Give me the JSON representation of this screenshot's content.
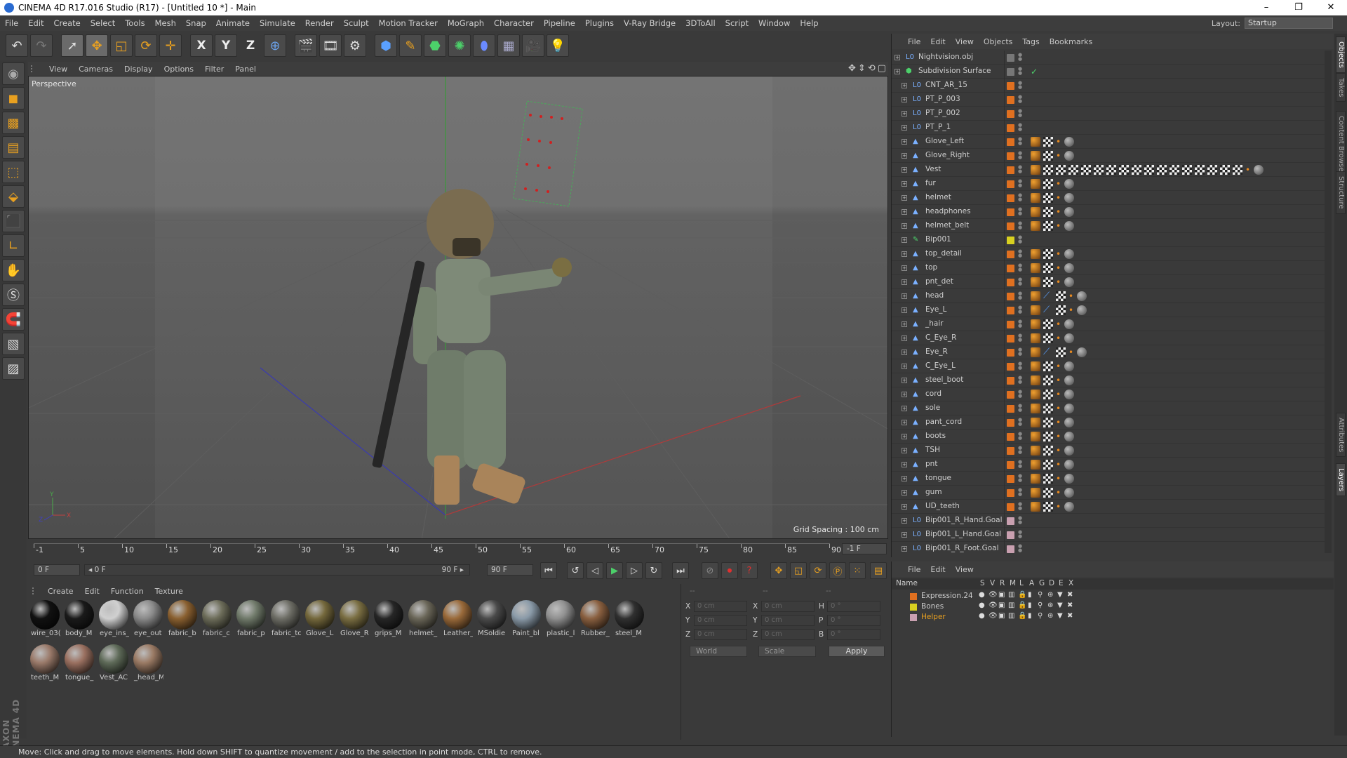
{
  "title": "CINEMA 4D R17.016 Studio (R17) - [Untitled 10 *] - Main",
  "window_controls": [
    "–",
    "❐",
    "✕"
  ],
  "menu": [
    "File",
    "Edit",
    "Create",
    "Select",
    "Tools",
    "Mesh",
    "Snap",
    "Animate",
    "Simulate",
    "Render",
    "Sculpt",
    "Motion Tracker",
    "MoGraph",
    "Character",
    "Pipeline",
    "Plugins",
    "V-Ray Bridge",
    "3DToAll",
    "Script",
    "Window",
    "Help"
  ],
  "layout_label": "Layout:",
  "layout_value": "Startup",
  "axis_buttons": [
    "X",
    "Y",
    "Z"
  ],
  "viewport": {
    "menu": [
      "View",
      "Cameras",
      "Display",
      "Options",
      "Filter",
      "Panel"
    ],
    "label": "Perspective",
    "grid": "Grid Spacing : 100 cm"
  },
  "timeline": {
    "ticks": [
      "-1",
      "5",
      "10",
      "15",
      "20",
      "25",
      "30",
      "35",
      "40",
      "45",
      "50",
      "55",
      "60",
      "65",
      "70",
      "75",
      "80",
      "85",
      "90"
    ],
    "end_field": "-1 F",
    "current": "0 F",
    "range_start": "◂ 0 F",
    "range_end": "90 F ▸",
    "max": "90 F"
  },
  "materials": {
    "menu": [
      "Create",
      "Edit",
      "Function",
      "Texture"
    ],
    "items": [
      {
        "name": "wire_03(",
        "color": "#111111"
      },
      {
        "name": "body_M",
        "color": "#1a1a1a"
      },
      {
        "name": "eye_ins_",
        "color": "#d0d0d0"
      },
      {
        "name": "eye_out",
        "color": "#8a8a8a"
      },
      {
        "name": "fabric_b",
        "color": "#8a6030"
      },
      {
        "name": "fabric_c",
        "color": "#6d6d5a"
      },
      {
        "name": "fabric_p",
        "color": "#707a6a"
      },
      {
        "name": "fabric_tc",
        "color": "#6e6e66"
      },
      {
        "name": "Glove_L",
        "color": "#74683c"
      },
      {
        "name": "Glove_R",
        "color": "#7a6e42"
      },
      {
        "name": "grips_M",
        "color": "#262626"
      },
      {
        "name": "helmet_",
        "color": "#6a6658"
      },
      {
        "name": "Leather_",
        "color": "#9a6a3a"
      },
      {
        "name": "MSoldie",
        "color": "#4a4a4a"
      },
      {
        "name": "Paint_bl",
        "color": "#8a9aa8"
      },
      {
        "name": "plastic_l",
        "color": "#909090"
      },
      {
        "name": "Rubber_",
        "color": "#8a6040"
      },
      {
        "name": "steel_M",
        "color": "#303030"
      },
      {
        "name": "teeth_M",
        "color": "#9a7a6a"
      },
      {
        "name": "tongue_",
        "color": "#9a7060"
      },
      {
        "name": "Vest_AC",
        "color": "#5e6a58"
      },
      {
        "name": "_head_M",
        "color": "#9a7a64"
      }
    ]
  },
  "coords": {
    "rows": [
      {
        "a": "X",
        "b": "X",
        "c": "H"
      },
      {
        "a": "Y",
        "b": "Y",
        "c": "P"
      },
      {
        "a": "Z",
        "b": "Z",
        "c": "B"
      }
    ],
    "pos_value": "0 cm",
    "size_value": "0 cm",
    "rot_value": "0 °",
    "header": [
      "--",
      "--",
      "--"
    ],
    "world": "World",
    "scale": "Scale",
    "apply": "Apply"
  },
  "objects": {
    "menu": [
      "File",
      "Edit",
      "View",
      "Objects",
      "Tags",
      "Bookmarks"
    ],
    "rows": [
      {
        "name": "Nightvision.obj",
        "kind": "null",
        "level": 0,
        "swatch": "#777777",
        "tags": "none"
      },
      {
        "name": "Subdivision Surface",
        "kind": "sds",
        "level": 0,
        "swatch": "#777777",
        "tags": "check"
      },
      {
        "name": "CNT_AR_15",
        "kind": "null",
        "level": 1,
        "swatch": "#e07020",
        "tags": "none"
      },
      {
        "name": "PT_P_003",
        "kind": "null",
        "level": 1,
        "swatch": "#e07020",
        "tags": "none"
      },
      {
        "name": "PT_P_002",
        "kind": "null",
        "level": 1,
        "swatch": "#e07020",
        "tags": "none"
      },
      {
        "name": "PT_P_1",
        "kind": "null",
        "level": 1,
        "swatch": "#e07020",
        "tags": "none"
      },
      {
        "name": "Glove_Left",
        "kind": "poly",
        "level": 1,
        "swatch": "#e07020",
        "tags": "std"
      },
      {
        "name": "Glove_Right",
        "kind": "poly",
        "level": 1,
        "swatch": "#e07020",
        "tags": "std"
      },
      {
        "name": "Vest",
        "kind": "poly",
        "level": 1,
        "swatch": "#e07020",
        "tags": "long"
      },
      {
        "name": "fur",
        "kind": "poly",
        "level": 1,
        "swatch": "#e07020",
        "tags": "std"
      },
      {
        "name": "helmet",
        "kind": "poly",
        "level": 1,
        "swatch": "#e07020",
        "tags": "std"
      },
      {
        "name": "headphones",
        "kind": "poly",
        "level": 1,
        "swatch": "#e07020",
        "tags": "std"
      },
      {
        "name": "helmet_belt",
        "kind": "poly",
        "level": 1,
        "swatch": "#e07020",
        "tags": "std"
      },
      {
        "name": "Bip001",
        "kind": "bone",
        "level": 1,
        "swatch": "#d8d020",
        "tags": "none"
      },
      {
        "name": "top_detail",
        "kind": "poly",
        "level": 1,
        "swatch": "#e07020",
        "tags": "std"
      },
      {
        "name": "top",
        "kind": "poly",
        "level": 1,
        "swatch": "#e07020",
        "tags": "std"
      },
      {
        "name": "pnt_det",
        "kind": "poly",
        "level": 1,
        "swatch": "#e07020",
        "tags": "std"
      },
      {
        "name": "head",
        "kind": "poly",
        "level": 1,
        "swatch": "#e07020",
        "tags": "ik"
      },
      {
        "name": "Eye_L",
        "kind": "poly",
        "level": 1,
        "swatch": "#e07020",
        "tags": "ik"
      },
      {
        "name": "_hair",
        "kind": "poly",
        "level": 1,
        "swatch": "#e07020",
        "tags": "std"
      },
      {
        "name": "C_Eye_R",
        "kind": "poly",
        "level": 1,
        "swatch": "#e07020",
        "tags": "std"
      },
      {
        "name": "Eye_R",
        "kind": "poly",
        "level": 1,
        "swatch": "#e07020",
        "tags": "ik"
      },
      {
        "name": "C_Eye_L",
        "kind": "poly",
        "level": 1,
        "swatch": "#e07020",
        "tags": "std"
      },
      {
        "name": "steel_boot",
        "kind": "poly",
        "level": 1,
        "swatch": "#e07020",
        "tags": "std"
      },
      {
        "name": "cord",
        "kind": "poly",
        "level": 1,
        "swatch": "#e07020",
        "tags": "std"
      },
      {
        "name": "sole",
        "kind": "poly",
        "level": 1,
        "swatch": "#e07020",
        "tags": "std"
      },
      {
        "name": "pant_cord",
        "kind": "poly",
        "level": 1,
        "swatch": "#e07020",
        "tags": "std"
      },
      {
        "name": "boots",
        "kind": "poly",
        "level": 1,
        "swatch": "#e07020",
        "tags": "std"
      },
      {
        "name": "TSH",
        "kind": "poly",
        "level": 1,
        "swatch": "#e07020",
        "tags": "std"
      },
      {
        "name": "pnt",
        "kind": "poly",
        "level": 1,
        "swatch": "#e07020",
        "tags": "std"
      },
      {
        "name": "tongue",
        "kind": "poly",
        "level": 1,
        "swatch": "#e07020",
        "tags": "std"
      },
      {
        "name": "gum",
        "kind": "poly",
        "level": 1,
        "swatch": "#e07020",
        "tags": "std"
      },
      {
        "name": "UD_teeth",
        "kind": "poly",
        "level": 1,
        "swatch": "#e07020",
        "tags": "std"
      },
      {
        "name": "Bip001_R_Hand.Goal",
        "kind": "null",
        "level": 1,
        "swatch": "#c9a0b0",
        "tags": "none"
      },
      {
        "name": "Bip001_L_Hand.Goal",
        "kind": "null",
        "level": 1,
        "swatch": "#c9a0b0",
        "tags": "none"
      },
      {
        "name": "Bip001_R_Foot.Goal",
        "kind": "null",
        "level": 1,
        "swatch": "#c9a0b0",
        "tags": "none"
      }
    ]
  },
  "layers": {
    "menu": [
      "File",
      "Edit",
      "View"
    ],
    "columns": [
      "Name",
      "S",
      "V",
      "R",
      "M",
      "L",
      "A",
      "G",
      "D",
      "E",
      "X"
    ],
    "rows": [
      {
        "name": "Expression.24",
        "color": "#e07020",
        "text": "#cccccc"
      },
      {
        "name": "Bones",
        "color": "#d8d020",
        "text": "#cccccc"
      },
      {
        "name": "Helper",
        "color": "#c9a0b0",
        "text": "#e8a020"
      }
    ]
  },
  "right_tabs": [
    "Objects",
    "Takes",
    "Content Browser",
    "Structure",
    "Attributes",
    "Layers"
  ],
  "brand": "MAXON CINEMA 4D",
  "status": "Move: Click and drag to move elements. Hold down SHIFT to quantize movement / add to the selection in point mode, CTRL to remove."
}
